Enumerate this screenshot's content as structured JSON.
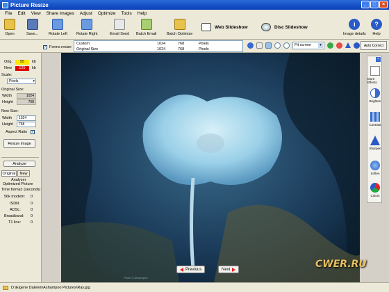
{
  "window": {
    "title": "Picture Resize",
    "buttons": [
      "_",
      "□",
      "×"
    ]
  },
  "menu": [
    "File",
    "Edit",
    "View",
    "Share images",
    "Adjust",
    "Optimize",
    "Tools",
    "Help"
  ],
  "toolbar": {
    "open": "Open",
    "save": "Save...",
    "rotate_left": "Rotate Left",
    "rotate_right": "Rotate Right",
    "email_send": "Email Send",
    "batch_email": "Batch Email",
    "batch_optimize": "Batch Optimize",
    "web_slideshow": "Web Slideshow",
    "disc_slideshow": "Disc Slideshow",
    "image_details": "Image details",
    "help": "Help"
  },
  "options": {
    "forms_resize": "Forms resize",
    "size_table": [
      {
        "name": "Custom",
        "w": "1024",
        "h": "768",
        "unit": "Pixels"
      },
      {
        "name": "Original Size",
        "w": "1024",
        "h": "768",
        "unit": "Pixels"
      }
    ],
    "zoom": "Fit screen",
    "auto_correct": "Auto Correct"
  },
  "left_panel": {
    "orig_label": "Orig.",
    "orig_value": "55",
    "orig_unit": "kb",
    "new_label": "New",
    "new_value": "125",
    "new_unit": "kb",
    "scale_label": "Scale:",
    "scale_value": "Pixels",
    "original_size_label": "Original Size:",
    "width_label": "Width",
    "orig_width": "1024",
    "height_label": "Height",
    "orig_height": "768",
    "new_size_label": "New Size:",
    "new_width": "1024",
    "new_height": "768",
    "aspect_ratio": "Aspect Ratio",
    "resize_button": "Resize image",
    "analyze_button": "Analyze",
    "tab_original": "Original",
    "tab_new": "New",
    "analyzer_title": "Analyzer",
    "analyzer_sub": "Optimized Picture",
    "time_format": "Time format: (seconds)",
    "speeds": [
      {
        "label": "56k modem:",
        "value": "0"
      },
      {
        "label": "ISDN:",
        "value": "0"
      },
      {
        "label": "ADSL:",
        "value": "0"
      },
      {
        "label": "Broadband:",
        "value": "0"
      },
      {
        "label": "T1 line:",
        "value": "0"
      }
    ]
  },
  "image_view": {
    "credit": "Photo © Ashampoo",
    "prev": "Previous",
    "next": "Next"
  },
  "right_panel": {
    "close": "×",
    "items": [
      "More Effects",
      "Brighten",
      "Contrast",
      "Sharpen",
      "Soften",
      "Colors"
    ]
  },
  "status": {
    "path": "D:\\Eigene Dateien\\Ashampoo Pictures\\Ray.jpg"
  },
  "watermark": "CWER.RU",
  "colors": {
    "orig_bg": "#ffe800",
    "new_bg": "#e00000",
    "title_bar": "#0a3fb8"
  }
}
